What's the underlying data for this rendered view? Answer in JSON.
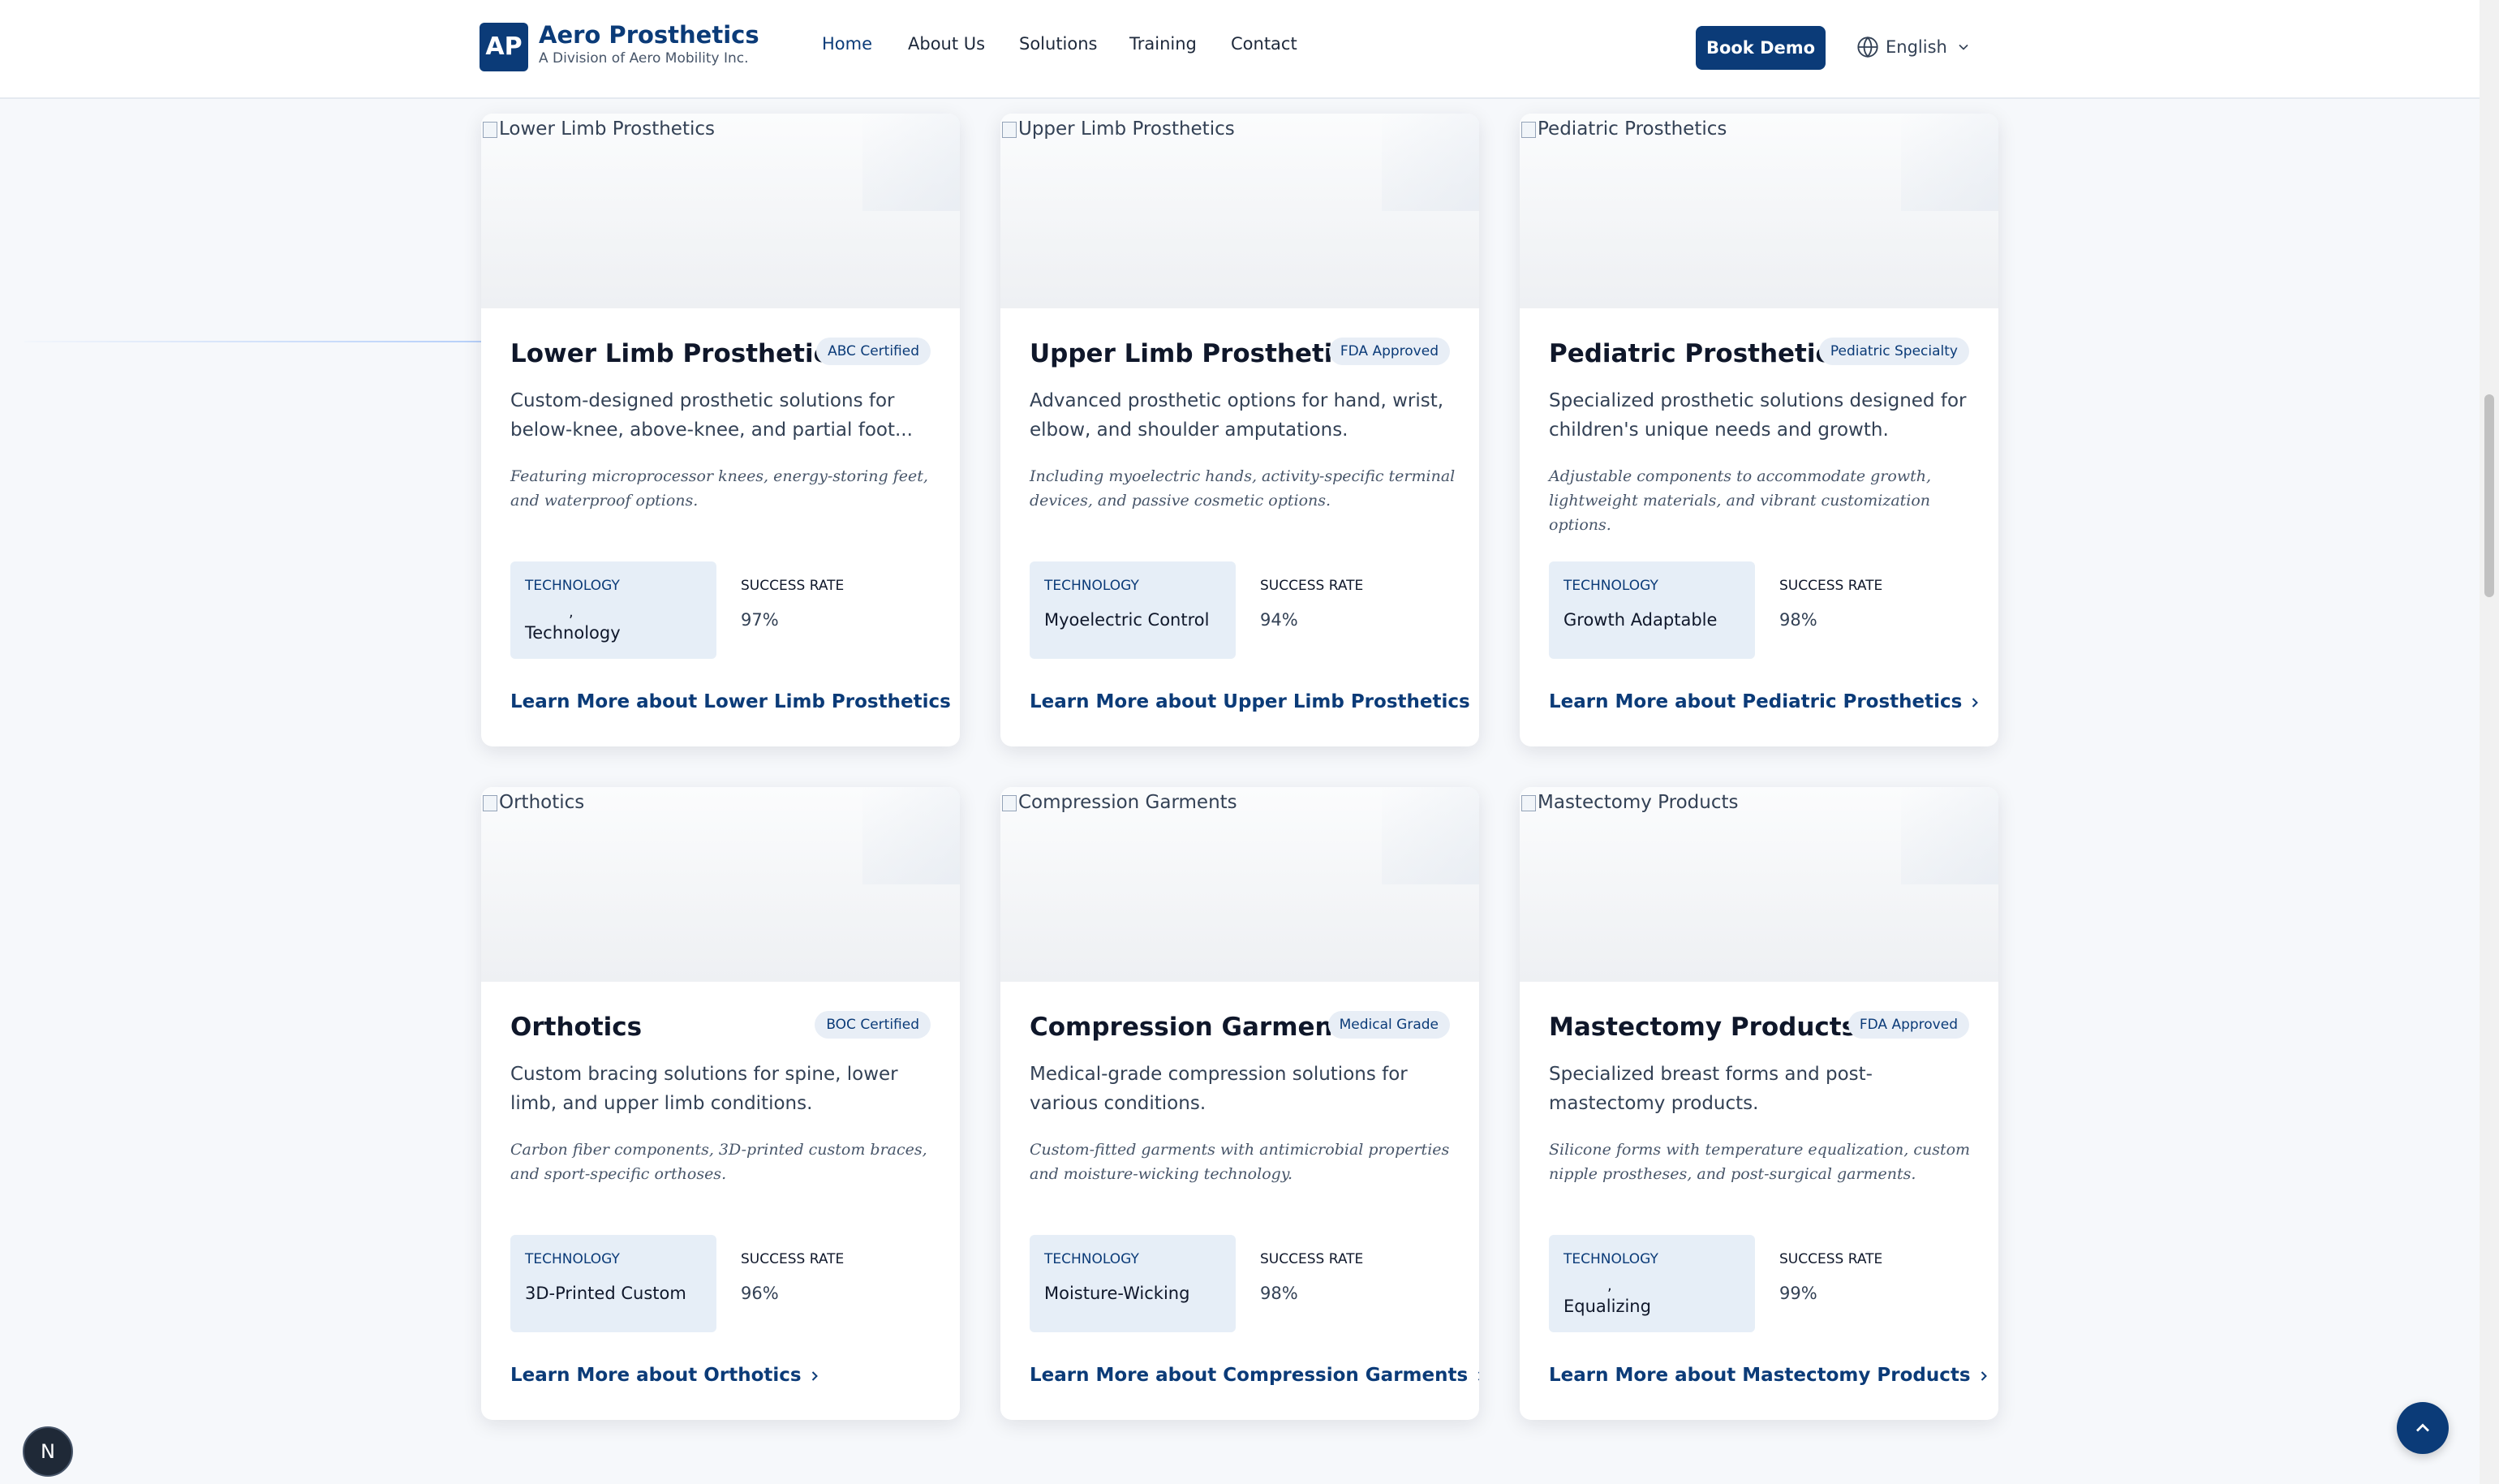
{
  "header": {
    "logo_initials": "AP",
    "brand_name": "Aero Prosthetics",
    "brand_subtitle": "A Division of Aero Mobility Inc.",
    "nav": [
      "Home",
      "About Us",
      "Solutions",
      "Training",
      "Contact"
    ],
    "active_nav": "Home",
    "book_demo": "Book Demo",
    "language": "English"
  },
  "cards": [
    {
      "image_alt": "Lower Limb Prosthetics",
      "title": "Lower Limb Prosthetics",
      "badge": "ABC Certified",
      "description": "Custom-designed prosthetic solutions for below-knee, above-knee, and partial foot...",
      "features": "Featuring microprocessor knees, energy-storing feet, and waterproof options.",
      "tech_label": "TECHNOLOGY",
      "tech_comma": ",",
      "tech_value": "Technology",
      "rate_label": "SUCCESS RATE",
      "rate_value": "97%",
      "link": "Learn More about Lower Limb Prosthetics"
    },
    {
      "image_alt": "Upper Limb Prosthetics",
      "title": "Upper Limb Prosthetics",
      "badge": "FDA Approved",
      "description": "Advanced prosthetic options for hand, wrist, elbow, and shoulder amputations.",
      "features": "Including myoelectric hands, activity-specific terminal devices, and passive cosmetic options.",
      "tech_label": "TECHNOLOGY",
      "tech_value": "Myoelectric Control",
      "rate_label": "SUCCESS RATE",
      "rate_value": "94%",
      "link": "Learn More about Upper Limb Prosthetics"
    },
    {
      "image_alt": "Pediatric Prosthetics",
      "title": "Pediatric Prosthetics",
      "badge": "Pediatric Specialty",
      "description": "Specialized prosthetic solutions designed for children's unique needs and growth.",
      "features": "Adjustable components to accommodate growth, lightweight materials, and vibrant customization options.",
      "tech_label": "TECHNOLOGY",
      "tech_value": "Growth Adaptable",
      "rate_label": "SUCCESS RATE",
      "rate_value": "98%",
      "link": "Learn More about Pediatric Prosthetics"
    },
    {
      "image_alt": "Orthotics",
      "title": "Orthotics",
      "badge": "BOC Certified",
      "description": "Custom bracing solutions for spine, lower limb, and upper limb conditions.",
      "features": "Carbon fiber components, 3D-printed custom braces, and sport-specific orthoses.",
      "tech_label": "TECHNOLOGY",
      "tech_value": "3D-Printed Custom",
      "rate_label": "SUCCESS RATE",
      "rate_value": "96%",
      "link": "Learn More about Orthotics"
    },
    {
      "image_alt": "Compression Garments",
      "title": "Compression Garments",
      "badge": "Medical Grade",
      "description": "Medical-grade compression solutions for various conditions.",
      "features": "Custom-fitted garments with antimicrobial properties and moisture-wicking technology.",
      "tech_label": "TECHNOLOGY",
      "tech_value": "Moisture-Wicking",
      "rate_label": "SUCCESS RATE",
      "rate_value": "98%",
      "link": "Learn More about Compression Garments"
    },
    {
      "image_alt": "Mastectomy Products",
      "title": "Mastectomy Products",
      "badge": "FDA Approved",
      "description": "Specialized breast forms and post-mastectomy products.",
      "features": "Silicone forms with temperature equalization, custom nipple prostheses, and post-surgical garments.",
      "tech_label": "TECHNOLOGY",
      "tech_comma": ",",
      "tech_value": "Equalizing",
      "rate_label": "SUCCESS RATE",
      "rate_value": "99%",
      "link": "Learn More about Mastectomy Products"
    }
  ],
  "floating": {
    "dev_badge": "N",
    "scroll_top_icon": "chevron-up-icon"
  },
  "colors": {
    "brand": "#0b3b78",
    "badge_bg": "#e8eef6",
    "tech_bg": "#e6eef7",
    "page_bg": "#f6f8fb"
  }
}
